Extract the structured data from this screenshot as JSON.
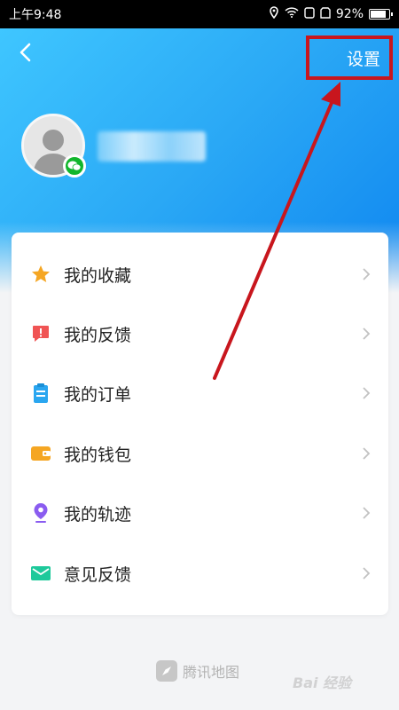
{
  "status_bar": {
    "time": "上午9:48",
    "battery": "92%",
    "battery_level": 0.92
  },
  "header": {
    "settings_label": "设置"
  },
  "menu": {
    "items": [
      {
        "label": "我的收藏",
        "icon": "star-icon",
        "color": "#f5a623"
      },
      {
        "label": "我的反馈",
        "icon": "feedback-alert-icon",
        "color": "#f05454"
      },
      {
        "label": "我的订单",
        "icon": "clipboard-icon",
        "color": "#2aa6f0"
      },
      {
        "label": "我的钱包",
        "icon": "wallet-icon",
        "color": "#f5a623"
      },
      {
        "label": "我的轨迹",
        "icon": "location-pin-icon",
        "color": "#8a5cf0"
      },
      {
        "label": "意见反馈",
        "icon": "mail-icon",
        "color": "#1ec99b"
      }
    ]
  },
  "footer": {
    "brand": "腾讯地图"
  },
  "watermark": {
    "text": "Bai 经验"
  },
  "colors": {
    "header_start": "#3fc6ff",
    "header_end": "#0f86f0",
    "annotation_red": "#c8161d",
    "wechat_green": "#11b62c"
  }
}
